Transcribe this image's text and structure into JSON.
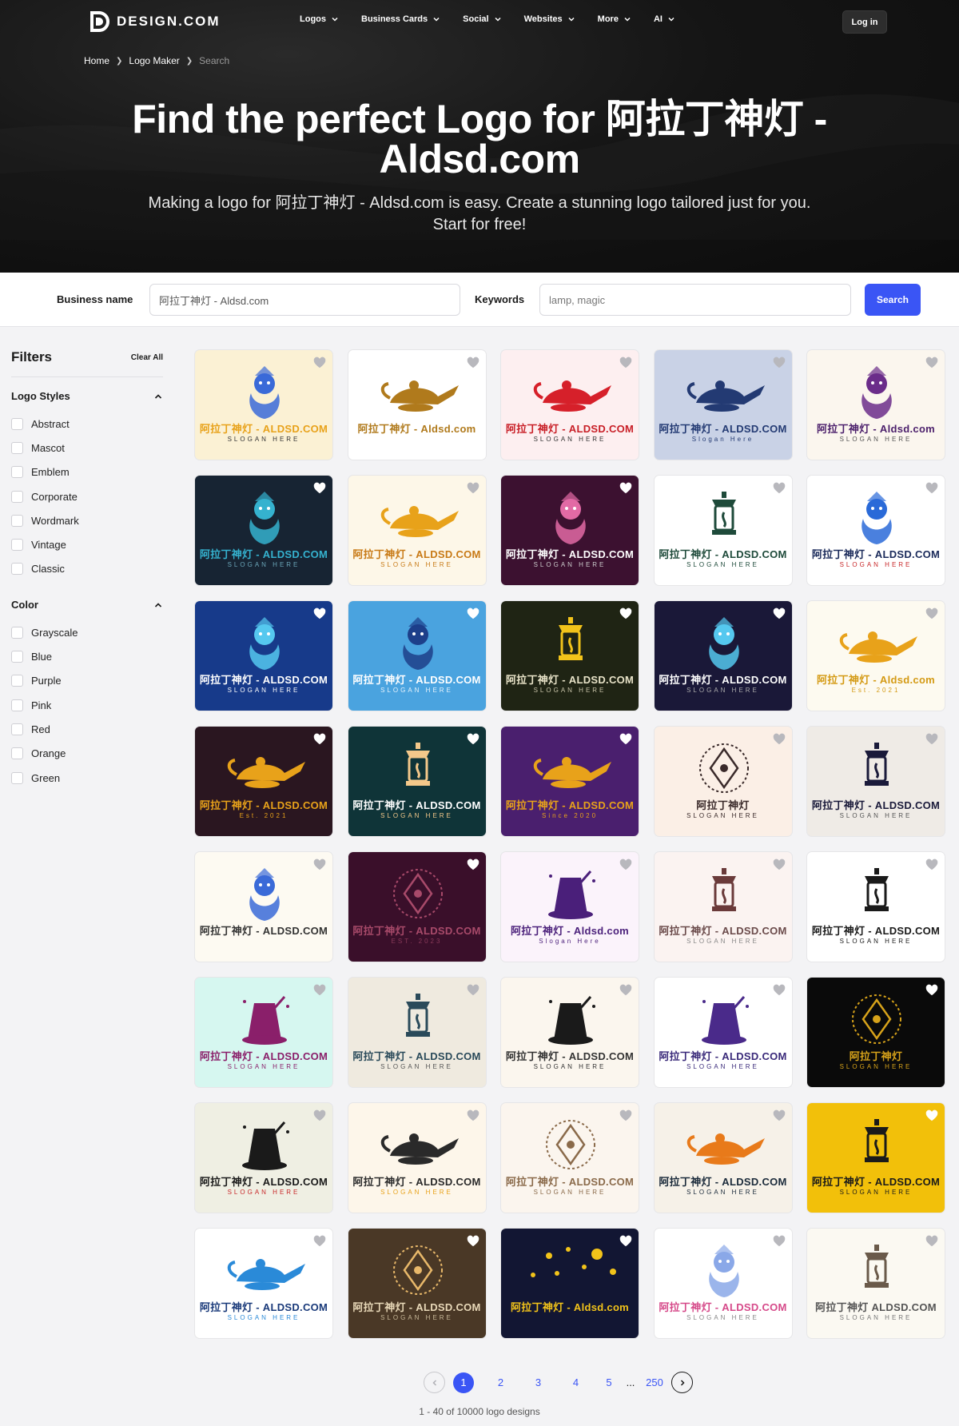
{
  "brand": {
    "name": "DESIGN.COM"
  },
  "nav": [
    {
      "label": "Logos"
    },
    {
      "label": "Business Cards"
    },
    {
      "label": "Social"
    },
    {
      "label": "Websites"
    },
    {
      "label": "More"
    },
    {
      "label": "AI"
    }
  ],
  "login_label": "Log in",
  "breadcrumb": [
    "Home",
    "Logo Maker",
    "Search"
  ],
  "hero": {
    "title": "Find the perfect Logo for 阿拉丁神灯 - Aldsd.com",
    "subtitle": "Making a logo for 阿拉丁神灯 - Aldsd.com is easy. Create a stunning logo tailored just for you. Start for free!"
  },
  "search": {
    "business_label": "Business name",
    "business_value": "阿拉丁神灯 - Aldsd.com",
    "keywords_label": "Keywords",
    "keywords_placeholder": "lamp, magic",
    "button": "Search"
  },
  "filters": {
    "title": "Filters",
    "clear_all": "Clear All",
    "groups": [
      {
        "title": "Logo Styles",
        "options": [
          "Abstract",
          "Mascot",
          "Emblem",
          "Corporate",
          "Wordmark",
          "Vintage",
          "Classic"
        ]
      },
      {
        "title": "Color",
        "options": [
          "Grayscale",
          "Blue",
          "Purple",
          "Pink",
          "Red",
          "Orange",
          "Green"
        ]
      }
    ]
  },
  "colors": {
    "accent": "#3a55f5",
    "hero_bg": "#111111"
  },
  "cards": [
    {
      "bg": "#fbf1d4",
      "icon": "genie",
      "ic": "#3a6ad8",
      "title": "阿拉丁神灯 - ALDSD.COM",
      "tc": "#e8a21a",
      "slogan": "SLOGAN HERE",
      "sc": "#333"
    },
    {
      "bg": "#ffffff",
      "icon": "lamp",
      "ic": "#b07a1c",
      "title": "阿拉丁神灯 - Aldsd.com",
      "tc": "#b07a1c",
      "slogan": "",
      "sc": "#333"
    },
    {
      "bg": "#fdeff0",
      "icon": "lamp",
      "ic": "#d6202a",
      "title": "阿拉丁神灯 - ALDSD.COM",
      "tc": "#c81e26",
      "slogan": "SLOGAN HERE",
      "sc": "#333"
    },
    {
      "bg": "#c9d2e6",
      "icon": "lamp",
      "ic": "#233a73",
      "title": "阿拉丁神灯 - ALDSD.COM",
      "tc": "#233a73",
      "slogan": "Slogan Here",
      "sc": "#233a73"
    },
    {
      "bg": "#fbf6ee",
      "icon": "genie",
      "ic": "#6b2d8a",
      "title": "阿拉丁神灯 - Aldsd.com",
      "tc": "#4b1f6b",
      "slogan": "SLOGAN HERE",
      "sc": "#555"
    },
    {
      "bg": "#172433",
      "icon": "genie",
      "ic": "#35b2cf",
      "title": "阿拉丁神灯 - ALDSD.COM",
      "tc": "#35b2cf",
      "slogan": "SLOGAN HERE",
      "sc": "#6aa5b8"
    },
    {
      "bg": "#fdf7e8",
      "icon": "lamp",
      "ic": "#e8a21a",
      "title": "阿拉丁神灯 - ALDSD.COM",
      "tc": "#c87a16",
      "slogan": "SLOGAN HERE",
      "sc": "#c87a16"
    },
    {
      "bg": "#3c1130",
      "icon": "genie",
      "ic": "#e26aa5",
      "title": "阿拉丁神灯 - ALDSD.COM",
      "tc": "#ffffff",
      "slogan": "SLOGAN HERE",
      "sc": "#cccccc"
    },
    {
      "bg": "#ffffff",
      "icon": "lantern",
      "ic": "#1e4a3a",
      "title": "阿拉丁神灯 - ALDSD.COM",
      "tc": "#1e4a3a",
      "slogan": "SLOGAN HERE",
      "sc": "#1e4a3a"
    },
    {
      "bg": "#ffffff",
      "icon": "genie",
      "ic": "#2a6ad8",
      "title": "阿拉丁神灯 - ALDSD.COM",
      "tc": "#1a2a5a",
      "slogan": "SLOGAN HERE",
      "sc": "#c8282a"
    },
    {
      "bg": "#173a8a",
      "icon": "genie",
      "ic": "#55c8ef",
      "title": "阿拉丁神灯 - ALDSD.COM",
      "tc": "#ffffff",
      "slogan": "SLOGAN HERE",
      "sc": "#ffffff"
    },
    {
      "bg": "#4aa3df",
      "icon": "genie",
      "ic": "#1d3f8a",
      "title": "阿拉丁神灯 - ALDSD.COM",
      "tc": "#ffffff",
      "slogan": "SLOGAN HERE",
      "sc": "#e7f3fc"
    },
    {
      "bg": "#1f2414",
      "icon": "lantern",
      "ic": "#f2c31a",
      "title": "阿拉丁神灯 - ALDSD.COM",
      "tc": "#e8e3c8",
      "slogan": "SLOGAN HERE",
      "sc": "#c8c3a8"
    },
    {
      "bg": "#1a1838",
      "icon": "genie",
      "ic": "#55c8ef",
      "title": "阿拉丁神灯 - ALDSD.COM",
      "tc": "#ffffff",
      "slogan": "SLOGAN HERE",
      "sc": "#aaaaaa"
    },
    {
      "bg": "#fdfaf0",
      "icon": "lamp",
      "ic": "#e8a21a",
      "title": "阿拉丁神灯 - Aldsd.com",
      "tc": "#d49a14",
      "slogan": "Est. 2021",
      "sc": "#d49a14"
    },
    {
      "bg": "#2a1620",
      "icon": "lamp",
      "ic": "#e8a21a",
      "title": "阿拉丁神灯 - ALDSD.COM",
      "tc": "#e8a21a",
      "slogan": "Est. 2021",
      "sc": "#e8a21a"
    },
    {
      "bg": "#0f3438",
      "icon": "lantern",
      "ic": "#f4c88a",
      "title": "阿拉丁神灯 - ALDSD.COM",
      "tc": "#ffffff",
      "slogan": "SLOGAN HERE",
      "sc": "#f4c88a"
    },
    {
      "bg": "#4a1f6e",
      "icon": "lamp",
      "ic": "#e8a21a",
      "title": "阿拉丁神灯 - ALDSD.COM",
      "tc": "#e8a21a",
      "slogan": "Since 2020",
      "sc": "#e8a21a"
    },
    {
      "bg": "#fbefe6",
      "icon": "emblem",
      "ic": "#3a2a2a",
      "title": "阿拉丁神灯",
      "tc": "#3a2a2a",
      "slogan": "SLOGAN HERE",
      "sc": "#3a2a2a"
    },
    {
      "bg": "#efebe6",
      "icon": "lantern",
      "ic": "#1a1a3a",
      "title": "阿拉丁神灯 - ALDSD.COM",
      "tc": "#1a1a3a",
      "slogan": "SLOGAN HERE",
      "sc": "#555"
    },
    {
      "bg": "#fdfaf2",
      "icon": "genie",
      "ic": "#3a6ad8",
      "title": "阿拉丁神灯 - ALDSD.COM",
      "tc": "#333333",
      "slogan": "",
      "sc": "#333"
    },
    {
      "bg": "#3a0f2a",
      "icon": "emblem",
      "ic": "#a84a6a",
      "title": "阿拉丁神灯 - ALDSD.COM",
      "tc": "#a84a6a",
      "slogan": "EST. 2023",
      "sc": "#8a3a5a"
    },
    {
      "bg": "#fbf3fb",
      "icon": "hat",
      "ic": "#4a1f7a",
      "title": "阿拉丁神灯 - Aldsd.com",
      "tc": "#4a1f7a",
      "slogan": "Slogan Here",
      "sc": "#4a1f7a"
    },
    {
      "bg": "#fbf3f1",
      "icon": "lantern",
      "ic": "#6a3a3a",
      "title": "阿拉丁神灯 - ALDSD.COM",
      "tc": "#6a4a4a",
      "slogan": "SLOGAN HERE",
      "sc": "#888"
    },
    {
      "bg": "#ffffff",
      "icon": "lantern",
      "ic": "#1a1a1a",
      "title": "阿拉丁神灯 - ALDSD.COM",
      "tc": "#1a1a1a",
      "slogan": "SLOGAN HERE",
      "sc": "#1a1a1a"
    },
    {
      "bg": "#d6f7f0",
      "icon": "hat",
      "ic": "#8a1f6a",
      "title": "阿拉丁神灯 - ALDSD.COM",
      "tc": "#8a1f6a",
      "slogan": "SLOGAN HERE",
      "sc": "#8a1f6a"
    },
    {
      "bg": "#efeadf",
      "icon": "lantern",
      "ic": "#2a4a5a",
      "title": "阿拉丁神灯 - ALDSD.COM",
      "tc": "#2a4a5a",
      "slogan": "SLOGAN HERE",
      "sc": "#555"
    },
    {
      "bg": "#fbf6ee",
      "icon": "hat",
      "ic": "#1a1a1a",
      "title": "阿拉丁神灯 - ALDSD.COM",
      "tc": "#333333",
      "slogan": "SLOGAN HERE",
      "sc": "#333"
    },
    {
      "bg": "#ffffff",
      "icon": "hat",
      "ic": "#4a2a8a",
      "title": "阿拉丁神灯 - ALDSD.COM",
      "tc": "#3a2a7a",
      "slogan": "SLOGAN HERE",
      "sc": "#3a2a7a"
    },
    {
      "bg": "#0a0a0a",
      "icon": "emblem",
      "ic": "#d6a21a",
      "title": "阿拉丁神灯",
      "tc": "#d6a21a",
      "slogan": "SLOGAN HERE",
      "sc": "#d6a21a"
    },
    {
      "bg": "#efefe3",
      "icon": "hat",
      "ic": "#1a1a1a",
      "title": "阿拉丁神灯 - ALDSD.COM",
      "tc": "#1a1a1a",
      "slogan": "SLOGAN HERE",
      "sc": "#c8282a"
    },
    {
      "bg": "#fdf6ea",
      "icon": "lamp",
      "ic": "#2a2a2a",
      "title": "阿拉丁神灯 - ALDSD.COM",
      "tc": "#2a2a2a",
      "slogan": "SLOGAN HERE",
      "sc": "#e8a21a"
    },
    {
      "bg": "#fbf5ee",
      "icon": "emblem",
      "ic": "#8a6a4a",
      "title": "阿拉丁神灯 - ALDSD.COM",
      "tc": "#8a6a4a",
      "slogan": "SLOGAN HERE",
      "sc": "#8a6a4a"
    },
    {
      "bg": "#f6f1e8",
      "icon": "lamp",
      "ic": "#e87a1a",
      "title": "阿拉丁神灯 - ALDSD.COM",
      "tc": "#1a2a3a",
      "slogan": "SLOGAN HERE",
      "sc": "#1a2a3a"
    },
    {
      "bg": "#f2c00a",
      "icon": "lantern",
      "ic": "#1a1a1a",
      "title": "阿拉丁神灯 - ALDSD.COM",
      "tc": "#1a1a1a",
      "slogan": "SLOGAN HERE",
      "sc": "#1a1a1a"
    },
    {
      "bg": "#ffffff",
      "icon": "lamp",
      "ic": "#2a8ad8",
      "title": "阿拉丁神灯 - ALDSD.COM",
      "tc": "#1a3a7a",
      "slogan": "SLOGAN HERE",
      "sc": "#2a8ad8"
    },
    {
      "bg": "#4a3826",
      "icon": "emblem",
      "ic": "#e8b86a",
      "title": "阿拉丁神灯 - ALDSD.COM",
      "tc": "#e8d8b8",
      "slogan": "SLOGAN HERE",
      "sc": "#c8b898"
    },
    {
      "bg": "#121633",
      "icon": "stars",
      "ic": "#f2c31a",
      "title": "阿拉丁神灯 - Aldsd.com",
      "tc": "#f2c31a",
      "slogan": "",
      "sc": "#f2c31a"
    },
    {
      "bg": "#ffffff",
      "icon": "genie",
      "ic": "#8aa8e8",
      "title": "阿拉丁神灯 - ALDSD.COM",
      "tc": "#d64a8a",
      "slogan": "SLOGAN HERE",
      "sc": "#888"
    },
    {
      "bg": "#fbf9f2",
      "icon": "lantern",
      "ic": "#6a5a4a",
      "title": "阿拉丁神灯 ALDSD.COM",
      "tc": "#555555",
      "slogan": "SLOGAN HERE",
      "sc": "#777"
    }
  ],
  "pagination": {
    "pages": [
      "1",
      "2",
      "3",
      "4",
      "5"
    ],
    "active": "1",
    "ellipsis": "...",
    "last": "250",
    "summary": "1 - 40 of 10000 logo designs"
  }
}
